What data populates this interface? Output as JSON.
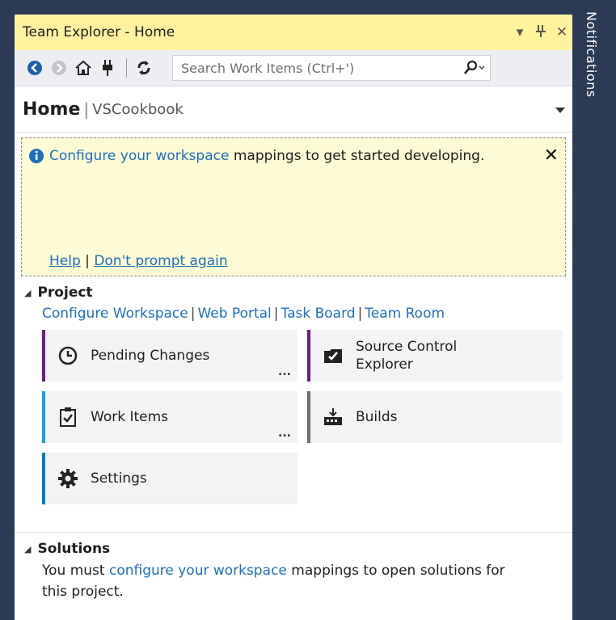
{
  "window": {
    "title": "Team Explorer - Home",
    "dropdown_icon": "▾",
    "pin_icon": "pin-icon",
    "close_icon": "✕"
  },
  "toolbar": {
    "search_placeholder": "Search Work Items (Ctrl+')",
    "icons": [
      "back-arrow-icon",
      "forward-arrow-icon",
      "home-icon",
      "connect-plug-icon",
      "refresh-icon",
      "search-icon"
    ]
  },
  "page": {
    "home_label": "Home",
    "separator": "|",
    "project_name": "VSCookbook"
  },
  "notice": {
    "link_text": "Configure your workspace",
    "message_rest": " mappings to get started developing.",
    "help_link": "Help",
    "separator": "|",
    "dont_prompt_link": "Don't prompt again",
    "close_label": "✕"
  },
  "project": {
    "heading": "Project",
    "links": [
      {
        "label": "Configure Workspace"
      },
      {
        "label": "Web Portal"
      },
      {
        "label": "Task Board"
      },
      {
        "label": "Team Room"
      }
    ],
    "tiles": [
      {
        "label": "Pending Changes",
        "more": "...",
        "accent": "#68217a",
        "icon": "clock-icon"
      },
      {
        "label": "Source Control Explorer",
        "more": "",
        "accent": "#68217a",
        "icon": "source-control-icon"
      },
      {
        "label": "Work Items",
        "more": "...",
        "accent": "#1ba1e2",
        "icon": "clipboard-check-icon"
      },
      {
        "label": "Builds",
        "more": "",
        "accent": "#6d6d6d",
        "icon": "build-icon"
      },
      {
        "label": "Settings",
        "more": "",
        "accent": "#007acc",
        "icon": "gear-icon"
      }
    ]
  },
  "solutions": {
    "heading": "Solutions",
    "text_before": "You must ",
    "link_text": "configure your workspace",
    "text_after": " mappings to open solutions for this project."
  },
  "notifications": {
    "label": "Notifications"
  },
  "colors": {
    "title_bar": "#fff29d",
    "notice_bg": "#fdfbd3",
    "link": "#1f6fbf",
    "frame": "#2b3a55"
  }
}
